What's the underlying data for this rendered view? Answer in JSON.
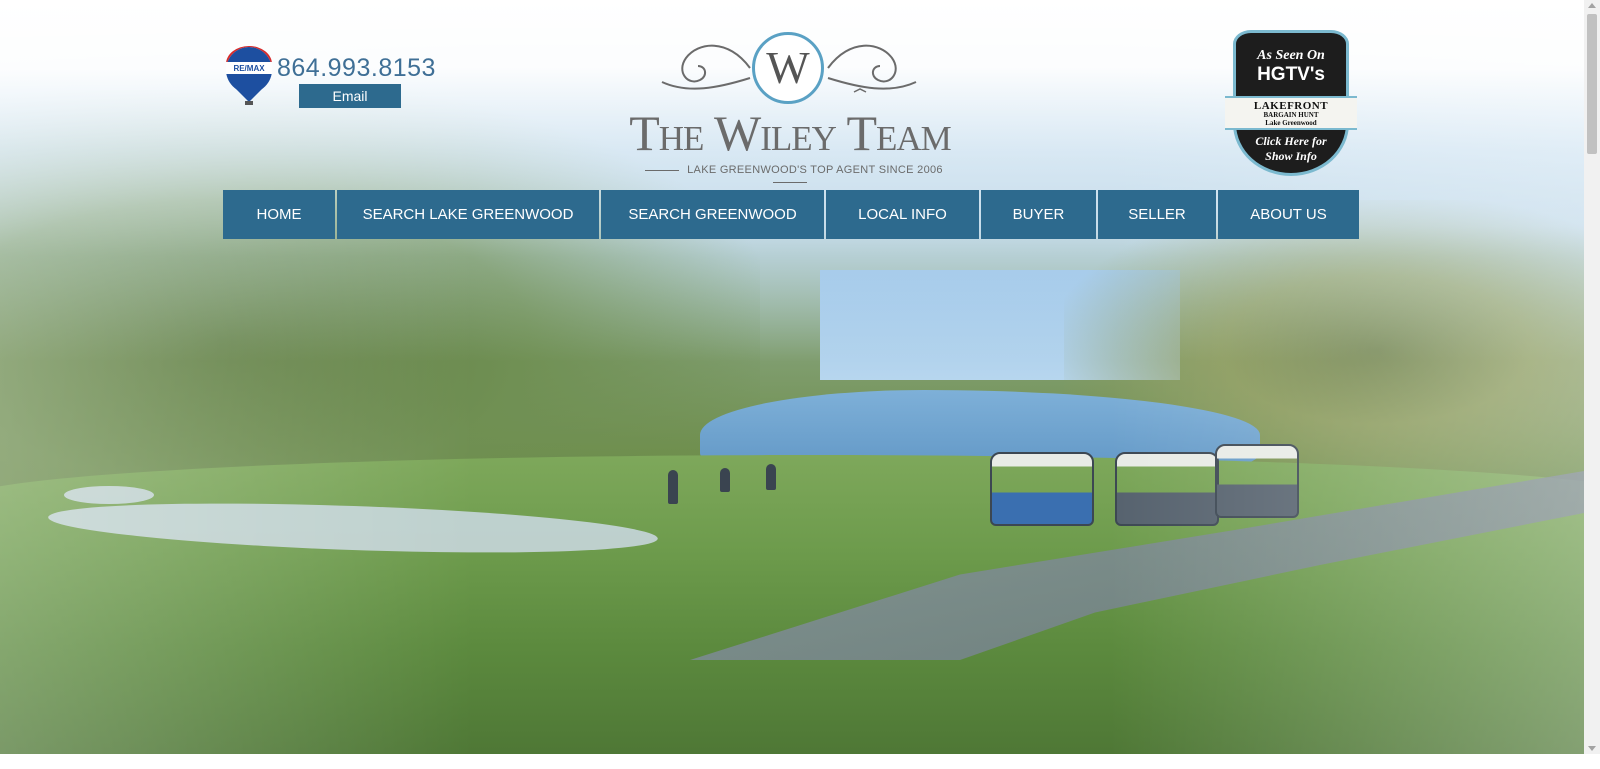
{
  "header": {
    "brand_logo_icon": "remax-balloon-icon",
    "phone": "864.993.8153",
    "email_label": "Email",
    "logo_initial": "W",
    "logo_title": "The Wiley Team",
    "logo_tagline": "LAKE GREENWOOD'S TOP AGENT SINCE 2006"
  },
  "hgtv_badge": {
    "line1": "As Seen On",
    "line2": "HGTV's",
    "ribbon_line1": "LAKEFRONT",
    "ribbon_line2": "BARGAIN HUNT",
    "ribbon_line3": "Lake Greenwood",
    "line3": "Click Here for",
    "line4": "Show Info"
  },
  "nav": {
    "items": [
      {
        "label": "HOME"
      },
      {
        "label": "SEARCH LAKE GREENWOOD"
      },
      {
        "label": "SEARCH GREENWOOD"
      },
      {
        "label": "LOCAL INFO"
      },
      {
        "label": "BUYER"
      },
      {
        "label": "SELLER"
      },
      {
        "label": "ABOUT US"
      }
    ]
  },
  "colors": {
    "nav_bg": "#2d6a8e",
    "phone_text": "#3f6f96",
    "logo_accent": "#5aa1c4"
  }
}
